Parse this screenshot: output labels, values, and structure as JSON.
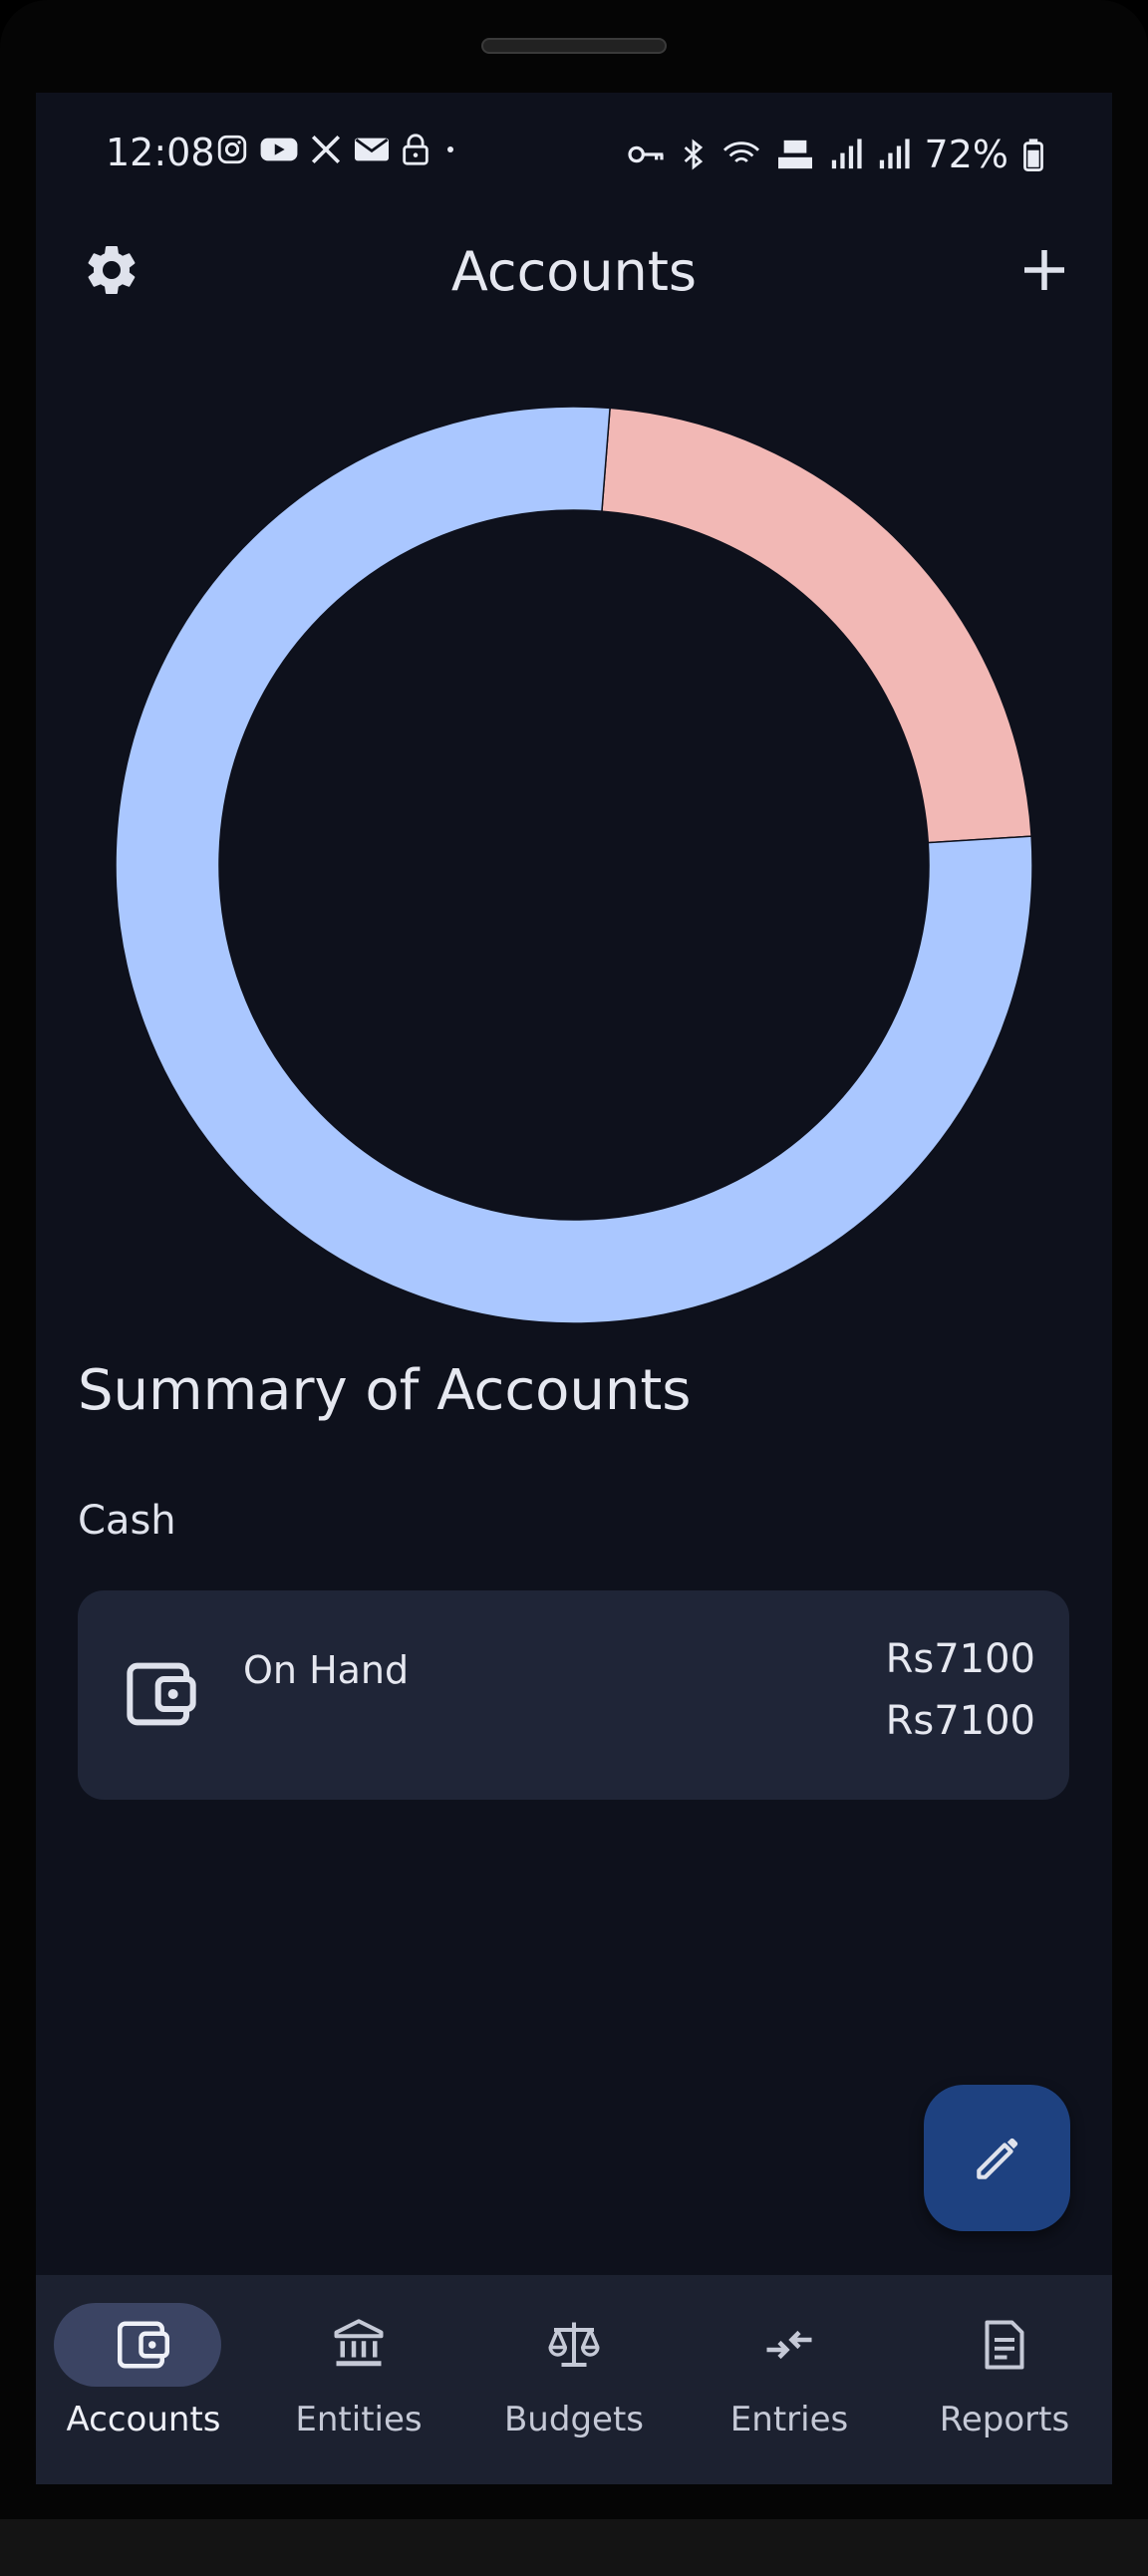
{
  "status_bar": {
    "time": "12:08",
    "battery_percent": "72%"
  },
  "header": {
    "title": "Accounts",
    "settings_icon": "gear-icon",
    "add_icon": "plus-icon"
  },
  "chart_data": {
    "type": "pie",
    "style": "donut",
    "slices": [
      {
        "value": 0.2275,
        "color": "#f2b8b5"
      },
      {
        "value": 0.7725,
        "color": "#aac7ff"
      }
    ]
  },
  "summary": {
    "title": "Summary of Accounts",
    "section_label": "Cash",
    "account": {
      "icon": "wallet-icon",
      "name": "On Hand",
      "amount_primary": "Rs7100",
      "amount_secondary": "Rs7100"
    }
  },
  "fab": {
    "icon": "pencil-icon"
  },
  "nav": {
    "items": [
      {
        "label": "Accounts",
        "icon": "wallet-icon",
        "active": true
      },
      {
        "label": "Entities",
        "icon": "bank-icon",
        "active": false
      },
      {
        "label": "Budgets",
        "icon": "scale-icon",
        "active": false
      },
      {
        "label": "Entries",
        "icon": "transfer-icon",
        "active": false
      },
      {
        "label": "Reports",
        "icon": "document-icon",
        "active": false
      }
    ]
  },
  "colors": {
    "background": "#0e111c",
    "card": "#1f2537",
    "accent_blue": "#aac7ff",
    "accent_pink": "#f2b8b5",
    "fab": "#1e4180",
    "nav_active": "#3b4463"
  }
}
